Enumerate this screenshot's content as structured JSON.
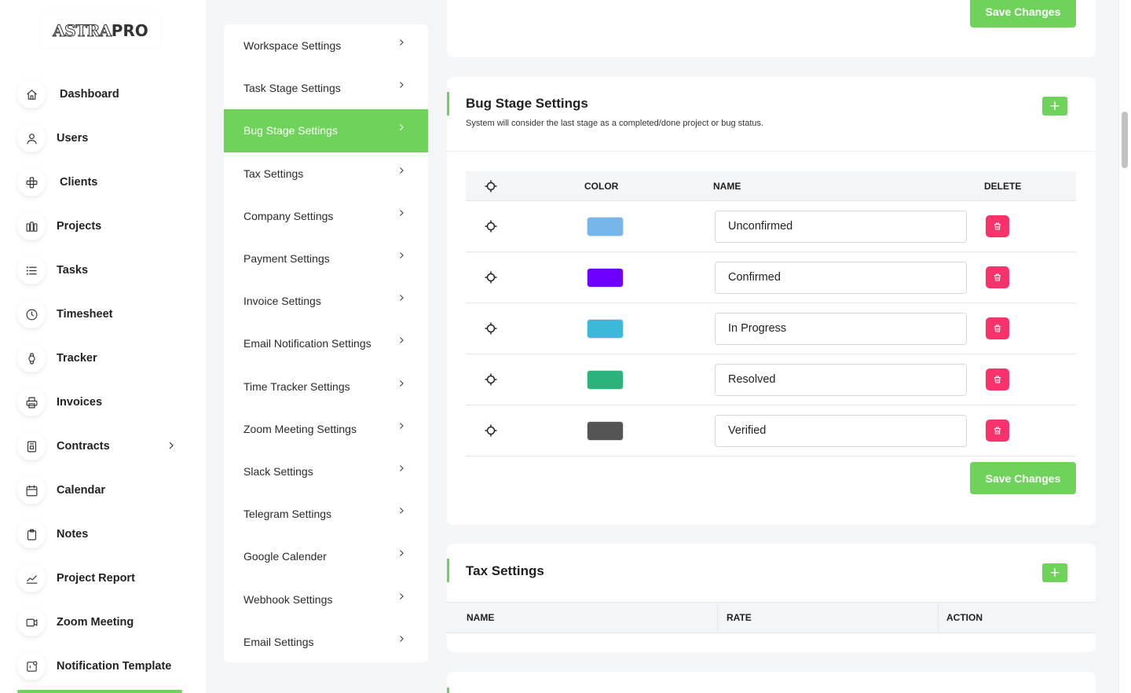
{
  "logo": {
    "text": "ASTRA",
    "bold": "PRO"
  },
  "nav": [
    {
      "label": "Dashboard",
      "icon": "home-icon"
    },
    {
      "label": "Users",
      "icon": "user-icon"
    },
    {
      "label": "Clients",
      "icon": "clients-icon"
    },
    {
      "label": "Projects",
      "icon": "projects-icon"
    },
    {
      "label": "Tasks",
      "icon": "list-icon"
    },
    {
      "label": "Timesheet",
      "icon": "clock-icon"
    },
    {
      "label": "Tracker",
      "icon": "watch-icon"
    },
    {
      "label": "Invoices",
      "icon": "printer-icon"
    },
    {
      "label": "Contracts",
      "icon": "contract-icon"
    },
    {
      "label": "Calendar",
      "icon": "calendar-icon"
    },
    {
      "label": "Notes",
      "icon": "clipboard-icon"
    },
    {
      "label": "Project Report",
      "icon": "chart-icon"
    },
    {
      "label": "Zoom Meeting",
      "icon": "video-icon"
    },
    {
      "label": "Notification Template",
      "icon": "notification-icon"
    }
  ],
  "settings_menu": [
    {
      "label": "Workspace Settings"
    },
    {
      "label": "Task Stage Settings"
    },
    {
      "label": "Bug Stage Settings",
      "active": true
    },
    {
      "label": "Tax Settings"
    },
    {
      "label": "Company Settings"
    },
    {
      "label": "Payment Settings"
    },
    {
      "label": "Invoice Settings"
    },
    {
      "label": "Email Notification Settings"
    },
    {
      "label": "Time Tracker Settings"
    },
    {
      "label": "Zoom Meeting Settings"
    },
    {
      "label": "Slack Settings"
    },
    {
      "label": "Telegram Settings"
    },
    {
      "label": "Google Calender"
    },
    {
      "label": "Webhook Settings"
    },
    {
      "label": "Email Settings"
    }
  ],
  "top_card": {
    "save_label": "Save Changes"
  },
  "bug_stage": {
    "title": "Bug Stage Settings",
    "subtitle": "System will consider the last stage as a completed/done project or bug status.",
    "add_label": "+",
    "columns": {
      "color": "COLOR",
      "name": "NAME",
      "delete": "DELETE"
    },
    "stages": [
      {
        "name": "Unconfirmed",
        "color": "#77b6ea"
      },
      {
        "name": "Confirmed",
        "color": "#6e00ff"
      },
      {
        "name": "In Progress",
        "color": "#3cb8d9"
      },
      {
        "name": "Resolved",
        "color": "#2cb37b"
      },
      {
        "name": "Verified",
        "color": "#545454"
      }
    ],
    "save_label": "Save Changes"
  },
  "tax": {
    "title": "Tax Settings",
    "add_label": "+",
    "columns": {
      "name": "NAME",
      "rate": "RATE",
      "action": "ACTION"
    }
  }
}
